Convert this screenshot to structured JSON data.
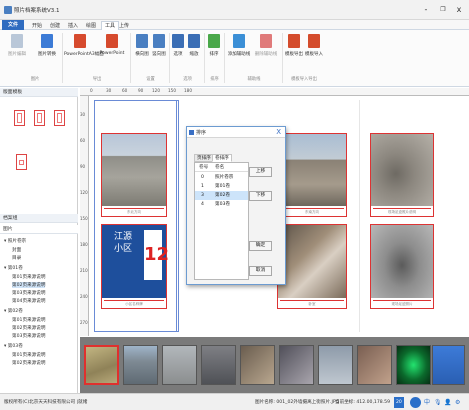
{
  "window": {
    "title": "照片档案系统V3.1",
    "controls": [
      "-",
      "❐",
      "x"
    ]
  },
  "menu_tabs": [
    {
      "label": "文件",
      "kind": "file"
    },
    {
      "label": "开始"
    },
    {
      "label": "创建"
    },
    {
      "label": "插入"
    },
    {
      "label": "绘图"
    },
    {
      "label": "工具",
      "active": true
    },
    {
      "label": "上传"
    }
  ],
  "ribbon": {
    "buttons": [
      {
        "label": "图片编辑",
        "disabled": true,
        "color": "#b9c7d8"
      },
      {
        "label": "图片转换",
        "color": "#3c7bd6"
      },
      {
        "label": "PowerPointA3幅面",
        "color": "#d64a2d"
      },
      {
        "label": "PowerPoint",
        "color": "#d64a2d"
      },
      {
        "label": "横向图",
        "color": "#4a7fc1"
      },
      {
        "label": "竖向图",
        "color": "#4a7fc1"
      },
      {
        "label": "选项",
        "color": "#3b6eb5"
      },
      {
        "label": "缩放",
        "color": "#3b6eb5"
      },
      {
        "label": "排序",
        "color": "#4aa84a"
      },
      {
        "label": "添加辅助线",
        "color": "#3b8fd6"
      },
      {
        "label": "删除辅助线",
        "disabled": true,
        "color": "#e07a7a"
      },
      {
        "label": "模板导出",
        "color": "#d44c2c"
      },
      {
        "label": "模板导入",
        "color": "#d44c2c"
      }
    ],
    "groups": [
      "图片",
      "导出",
      "设置",
      "选项",
      "排序",
      "辅助线",
      "模板导入导出"
    ]
  },
  "left_panel": {
    "layout_header": "版面模板",
    "catalog_header": "档案组",
    "catalog_sub": "图片",
    "tree": [
      {
        "label": "▾ 照片卷宗",
        "level": 0
      },
      {
        "label": "封面",
        "level": 1
      },
      {
        "label": "目录",
        "level": 1
      },
      {
        "label": "▾ 第01卷",
        "level": 0
      },
      {
        "label": "第01页来源说明",
        "level": 1
      },
      {
        "label": "第02页来源说明",
        "level": 1,
        "selected": true
      },
      {
        "label": "第03页来源说明",
        "level": 1
      },
      {
        "label": "第04页来源说明",
        "level": 1
      },
      {
        "label": "▾ 第02卷",
        "level": 0
      },
      {
        "label": "第01页来源说明",
        "level": 1
      },
      {
        "label": "第02页来源说明",
        "level": 1
      },
      {
        "label": "第03页来源说明",
        "level": 1
      },
      {
        "label": "▾ 第03卷",
        "level": 0
      },
      {
        "label": "第01页来源说明",
        "level": 1
      },
      {
        "label": "第02页来源说明",
        "level": 1
      }
    ]
  },
  "ruler": {
    "h_labels": [
      "0",
      "30",
      "60",
      "90",
      "120",
      "150",
      "180"
    ],
    "v_labels": [
      "30",
      "60",
      "90",
      "120",
      "150",
      "180",
      "210",
      "240",
      "270"
    ]
  },
  "canvas": {
    "captions": [
      "东北方向",
      "现场照片",
      "东南方向",
      "现场照片",
      "现场足迹照片说明",
      "小区名称牌",
      "楼道入口",
      "卧室",
      "现场足迹照片"
    ]
  },
  "dialog": {
    "title": "排序",
    "close": "X",
    "tabs": [
      "页排序",
      "卷排序"
    ],
    "columns": [
      "卷号",
      "卷名"
    ],
    "rows": [
      {
        "num": "0",
        "name": "照片卷宗"
      },
      {
        "num": "1",
        "name": "第01卷"
      },
      {
        "num": "3",
        "name": "第02卷",
        "selected": true
      },
      {
        "num": "4",
        "name": "第03卷"
      }
    ],
    "buttons": {
      "up": "上移",
      "down": "下移",
      "ok": "确定",
      "cancel": "取消"
    }
  },
  "statusbar": {
    "company": "版权所有(C)北京天天科技有限公司 |就绪",
    "file": "图片名称: 001_02外墙摄离上街照片.JPG",
    "coords": "当前坐标: 412.00,178.59",
    "zoom": "20",
    "icons": [
      "ime-icon",
      "lang-icon",
      "mic-icon",
      "user-icon",
      "settings-icon"
    ],
    "ime_label": "中"
  }
}
